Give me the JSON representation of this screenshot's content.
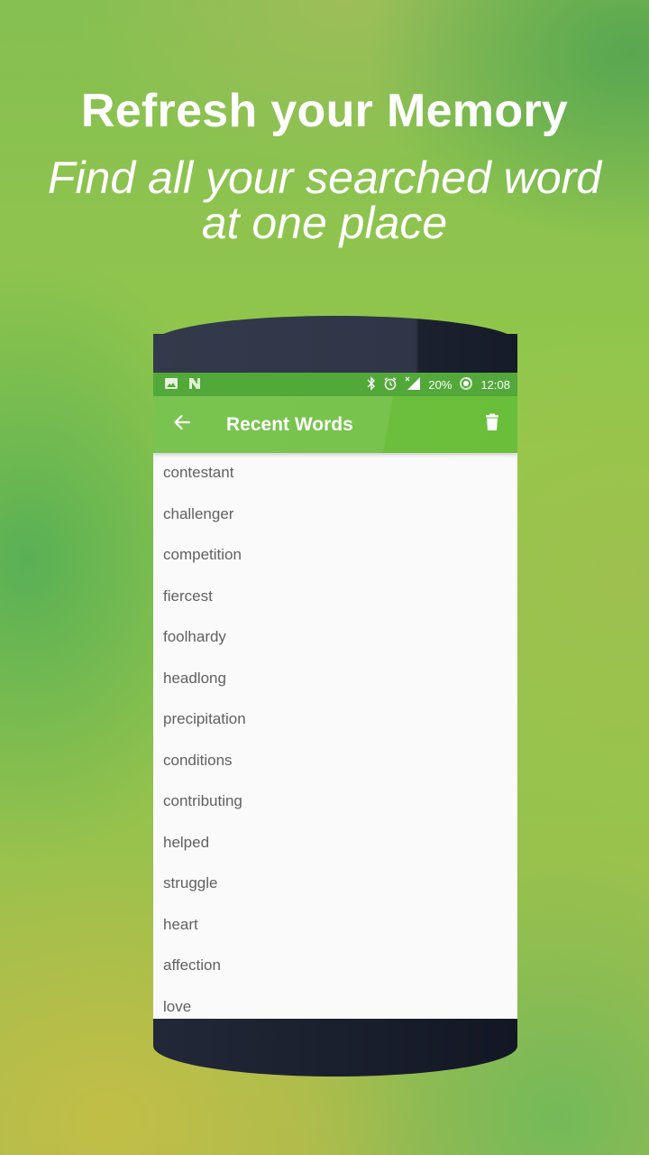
{
  "promo": {
    "headline": "Refresh your Memory",
    "subline_1": "Find all your searched word",
    "subline_2": "at one place"
  },
  "statusbar": {
    "left_icons": [
      "image-icon",
      "n-notification-icon"
    ],
    "right_icons": [
      "bluetooth-icon",
      "alarm-icon",
      "signal-icon",
      "battery-saver-icon"
    ],
    "battery": "20%",
    "time": "12:08"
  },
  "appbar": {
    "title": "Recent Words",
    "back_icon": "arrow-left-icon",
    "action_icon": "trash-icon"
  },
  "recent_words": [
    "contestant",
    "challenger",
    "competition",
    "fiercest",
    "foolhardy",
    "headlong",
    "precipitation",
    "conditions",
    "contributing",
    "helped",
    "struggle",
    "heart",
    "affection",
    "love"
  ],
  "colors": {
    "statusbar": "#53a83a",
    "appbar": "#79c450",
    "list_text": "#616161",
    "list_bg": "#fafafa"
  }
}
